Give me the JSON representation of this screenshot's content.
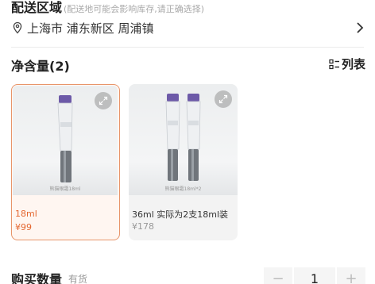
{
  "delivery": {
    "title": "配送区域",
    "note": "(配送地可能会影响库存,请正确选择)",
    "address": "上海市 浦东新区 周浦镇"
  },
  "net_content": {
    "title": "净含量(2)",
    "list_label": "列表",
    "options": [
      {
        "label": "18ml",
        "price": "¥99",
        "image_caption": "熊猫眼霜18ml",
        "selected": true
      },
      {
        "label": "36ml 实际为2支18ml装",
        "price": "¥178",
        "image_caption": "熊猫眼霜18ml*2",
        "selected": false
      }
    ]
  },
  "quantity": {
    "title": "购买数量",
    "stock": "有货",
    "value": "1",
    "minus": "−",
    "plus": "+"
  },
  "colors": {
    "accent": "#e4662f",
    "selected_border": "#e8956a"
  }
}
